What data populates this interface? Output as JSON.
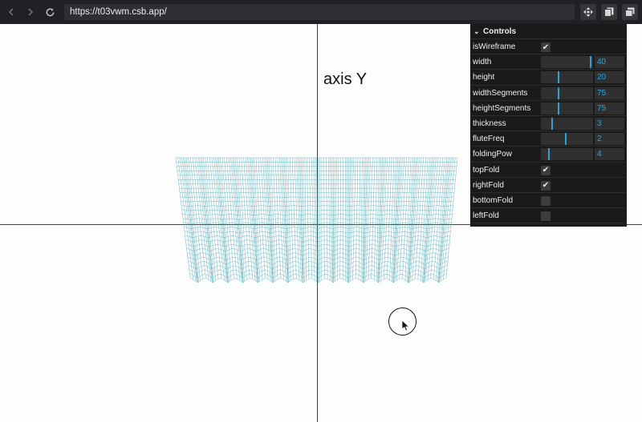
{
  "browser": {
    "url": "https://t03vwm.csb.app/"
  },
  "scene": {
    "axis_label": "axis Y",
    "mesh_color": "#4aa7b3"
  },
  "controls": {
    "title": "Controls",
    "rows": [
      {
        "label": "isWireframe",
        "kind": "checkbox",
        "checked": true
      },
      {
        "label": "width",
        "kind": "slider",
        "value": "40",
        "fraction": 0.97
      },
      {
        "label": "height",
        "kind": "slider",
        "value": "20",
        "fraction": 0.33
      },
      {
        "label": "widthSegments",
        "kind": "slider",
        "value": "75",
        "fraction": 0.33
      },
      {
        "label": "heightSegments",
        "kind": "slider",
        "value": "75",
        "fraction": 0.33
      },
      {
        "label": "thickness",
        "kind": "slider",
        "value": "3",
        "fraction": 0.2
      },
      {
        "label": "fluteFreq",
        "kind": "slider",
        "value": "2",
        "fraction": 0.48
      },
      {
        "label": "foldingPow",
        "kind": "slider",
        "value": "4",
        "fraction": 0.15
      },
      {
        "label": "topFold",
        "kind": "checkbox",
        "checked": true
      },
      {
        "label": "rightFold",
        "kind": "checkbox",
        "checked": true
      },
      {
        "label": "bottomFold",
        "kind": "checkbox",
        "checked": false
      },
      {
        "label": "leftFold",
        "kind": "checkbox",
        "checked": false
      }
    ],
    "accent": "#2fa1d6",
    "check_glyph": "✔"
  }
}
